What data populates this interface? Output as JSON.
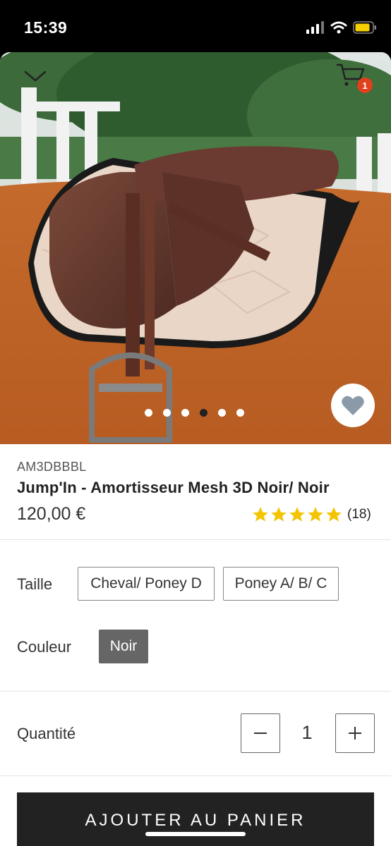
{
  "status_bar": {
    "time": "15:39"
  },
  "header": {
    "cart_count": "1"
  },
  "gallery": {
    "image_count": 6,
    "active_index": 3
  },
  "product": {
    "sku": "AM3DBBBL",
    "title": "Jump'In - Amortisseur Mesh 3D Noir/ Noir",
    "price": "120,00 €",
    "rating": 5,
    "review_count": "(18)"
  },
  "options": {
    "size_label": "Taille",
    "sizes": [
      "Cheval/ Poney D",
      "Poney A/ B/ C"
    ],
    "color_label": "Couleur",
    "colors": [
      "Noir"
    ]
  },
  "quantity": {
    "label": "Quantité",
    "value": "1"
  },
  "cta": {
    "add_to_cart": "AJOUTER AU PANIER"
  },
  "colors": {
    "accent_badge": "#e0401c",
    "star": "#f5c400",
    "button_dark": "#222222",
    "selected_color_bg": "#666666"
  },
  "icons": [
    "chevron-down-icon",
    "cart-icon",
    "heart-icon",
    "star-icon",
    "minus-icon",
    "plus-icon",
    "signal-icon",
    "wifi-icon",
    "battery-icon"
  ]
}
